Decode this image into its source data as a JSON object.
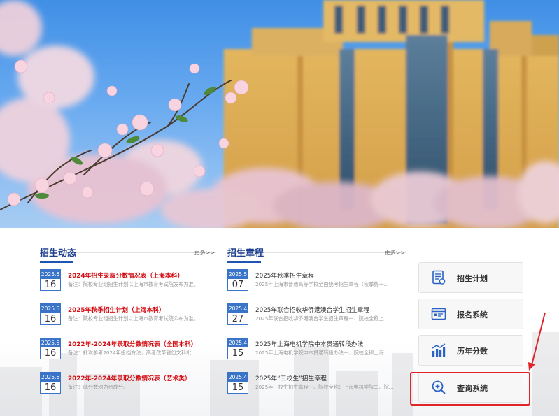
{
  "news": {
    "title": "招生动态",
    "more": "更多>>",
    "items": [
      {
        "ym": "2025.6",
        "day": "16",
        "title": "2024年招生录取分数情况表（上海本科）",
        "desc": "备注：院校专业组招生计划以上海市教育考试院发布为准。"
      },
      {
        "ym": "2025.6",
        "day": "16",
        "title": "2025年秋季招生计划（上海本科）",
        "desc": "备注：院校专业组招生计划以上海市教育考试院公布为准。"
      },
      {
        "ym": "2025.6",
        "day": "16",
        "title": "2022年-2024年录取分数情况表（全国本科）",
        "desc": "备注：批次参考2024年投档方法，高考改革省份文科批..."
      },
      {
        "ym": "2025.6",
        "day": "16",
        "title": "2022年-2024年录取分数情况表（艺术类）",
        "desc": "备注：此分数均为合成分。"
      }
    ]
  },
  "rules": {
    "title": "招生章程",
    "more": "更多>>",
    "items": [
      {
        "ym": "2025.5",
        "day": "07",
        "title": "2025年秋季招生章程",
        "desc": "2025年上海市普通高等学校全国统考招生章程（秋季统一..."
      },
      {
        "ym": "2025.4",
        "day": "27",
        "title": "2025年联合招收华侨港澳台学生招生章程",
        "desc": "2025年联合招收华侨港澳台学生招生章程一、院校全称上..."
      },
      {
        "ym": "2025.4",
        "day": "15",
        "title": "2025年上海电机学院中本贯通转段办法",
        "desc": "2025年上海电机学院中本贯通转段办法一、院校全称上海..."
      },
      {
        "ym": "2025.4",
        "day": "15",
        "title": "2025年“三校生”招生章程",
        "desc": "2025年三校生招生章程一、院校全称：上海电机学院二、院..."
      }
    ]
  },
  "quick": [
    {
      "label": "招生计划",
      "icon": "document-icon"
    },
    {
      "label": "报名系统",
      "icon": "id-card-icon"
    },
    {
      "label": "历年分数",
      "icon": "bar-chart-icon"
    },
    {
      "label": "查询系统",
      "icon": "search-plus-icon"
    }
  ],
  "colors": {
    "accent": "#1c55b2",
    "date_blue": "#3a74c9",
    "news_red": "#d40d12",
    "highlight_red": "#e0242a"
  }
}
